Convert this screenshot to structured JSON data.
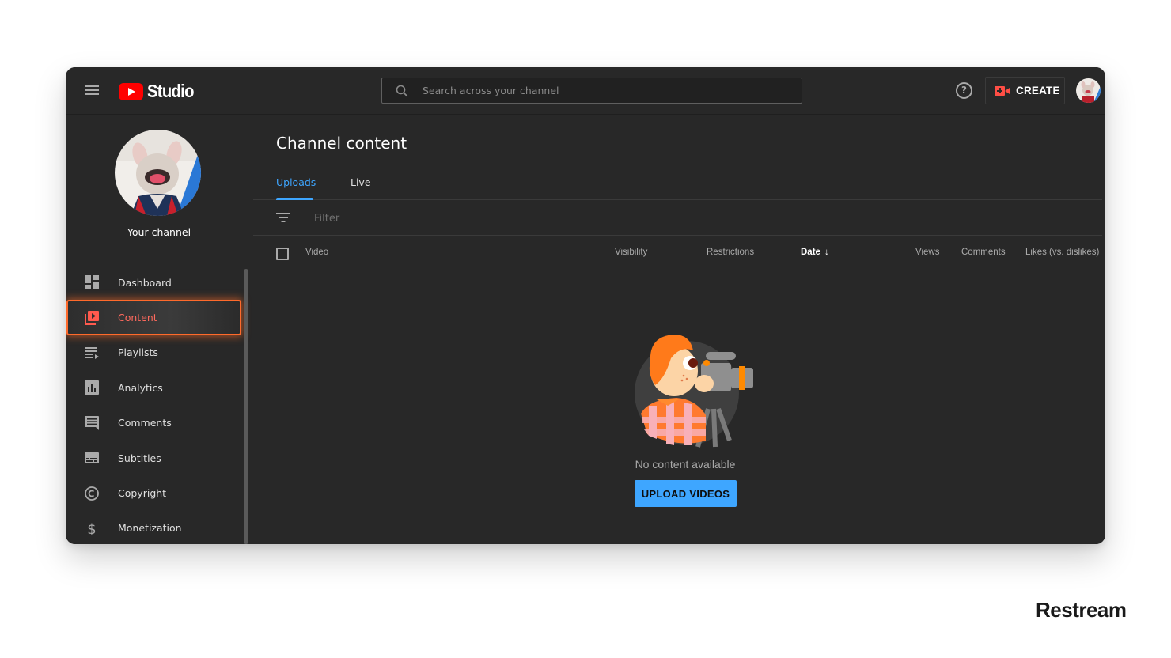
{
  "header": {
    "app_name": "Studio",
    "search_placeholder": "Search across your channel",
    "create_label": "CREATE",
    "help_glyph": "?"
  },
  "sidebar": {
    "channel_label": "Your channel",
    "items": [
      {
        "label": "Dashboard",
        "icon": "dashboard-icon",
        "active": false
      },
      {
        "label": "Content",
        "icon": "content-icon",
        "active": true
      },
      {
        "label": "Playlists",
        "icon": "playlists-icon",
        "active": false
      },
      {
        "label": "Analytics",
        "icon": "analytics-icon",
        "active": false
      },
      {
        "label": "Comments",
        "icon": "comments-icon",
        "active": false
      },
      {
        "label": "Subtitles",
        "icon": "subtitles-icon",
        "active": false
      },
      {
        "label": "Copyright",
        "icon": "copyright-icon",
        "active": false
      },
      {
        "label": "Monetization",
        "icon": "monetization-icon",
        "active": false
      }
    ]
  },
  "main": {
    "title": "Channel content",
    "tabs": [
      {
        "label": "Uploads",
        "active": true
      },
      {
        "label": "Live",
        "active": false
      }
    ],
    "filter_placeholder": "Filter",
    "columns": [
      {
        "label": "Video"
      },
      {
        "label": "Visibility"
      },
      {
        "label": "Restrictions"
      },
      {
        "label": "Date",
        "sorted": "descending",
        "sort_glyph": "↓"
      },
      {
        "label": "Views"
      },
      {
        "label": "Comments"
      },
      {
        "label": "Likes (vs. dislikes)"
      }
    ],
    "empty_message": "No content available",
    "upload_button": "UPLOAD VIDEOS"
  },
  "colors": {
    "accent_blue": "#3ea6ff",
    "youtube_red": "#ff0000",
    "active_highlight": "#ff6a2b",
    "background": "#282828"
  },
  "watermark": "Restream"
}
